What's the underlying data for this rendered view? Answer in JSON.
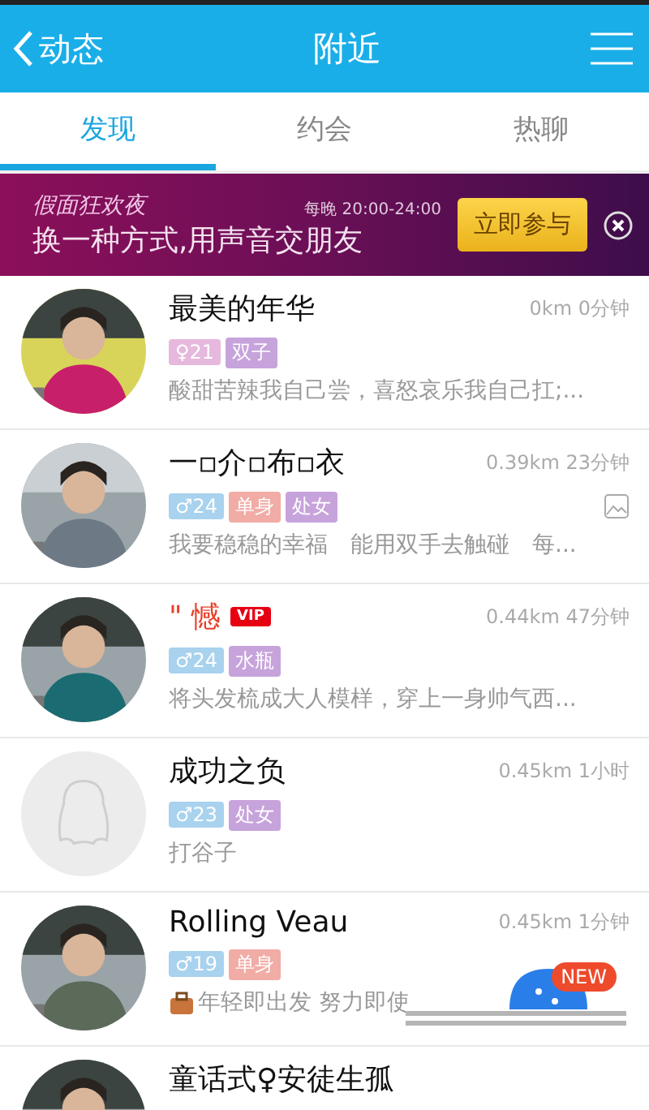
{
  "header": {
    "back_label": "动态",
    "title": "附近"
  },
  "tabs": [
    {
      "label": "发现",
      "selected": true
    },
    {
      "label": "约会",
      "selected": false
    },
    {
      "label": "热聊",
      "selected": false
    }
  ],
  "banner": {
    "event_title": "假面狂欢夜",
    "schedule": "每晚 20:00-24:00",
    "slogan": "换一种方式,用声音交朋友",
    "button": "立即参与"
  },
  "people": [
    {
      "name": "最美的年华",
      "distance_time": "0km 0分钟",
      "default_avatar": false,
      "tags": [
        {
          "text": "♀21",
          "color": "#e6b8dd"
        },
        {
          "text": "双子",
          "color": "#c7a3dc"
        }
      ],
      "status": "酸甜苦辣我自己尝，喜怒哀乐我自己扛;...",
      "has_photos": false,
      "status_icon": false
    },
    {
      "name": "一▫介▫布▫衣",
      "distance_time": "0.39km 23分钟",
      "default_avatar": false,
      "tags": [
        {
          "text": "♂24",
          "color": "#a8d2ee"
        },
        {
          "text": "单身",
          "color": "#f1aca6"
        },
        {
          "text": "处女",
          "color": "#c7a3dc"
        }
      ],
      "status": "我要稳稳的幸福　能用双手去触碰　每...",
      "has_photos": true,
      "status_icon": false
    },
    {
      "name": "\" 憾",
      "badge": "VIP",
      "distance_time": "0.44km 47分钟",
      "default_avatar": false,
      "tags": [
        {
          "text": "♂24",
          "color": "#a8d2ee"
        },
        {
          "text": "水瓶",
          "color": "#c7a3dc"
        }
      ],
      "status": "将头发梳成大人模样，穿上一身帅气西...",
      "has_photos": false,
      "status_icon": false
    },
    {
      "name": "成功之负",
      "distance_time": "0.45km 1小时",
      "default_avatar": true,
      "tags": [
        {
          "text": "♂23",
          "color": "#a8d2ee"
        },
        {
          "text": "处女",
          "color": "#c7a3dc"
        }
      ],
      "status": "打谷子",
      "has_photos": false,
      "status_icon": false
    },
    {
      "name": "Rolling Veau",
      "distance_time": "0.45km 1分钟",
      "default_avatar": false,
      "tags": [
        {
          "text": "♂19",
          "color": "#a8d2ee"
        },
        {
          "text": "单身",
          "color": "#f1aca6"
        }
      ],
      "status": "年轻即出发 努力即使",
      "has_photos": false,
      "status_icon": true
    },
    {
      "name": "童话式♀安徒生孤",
      "default_avatar": false,
      "has_photos": false,
      "status_icon": false
    }
  ],
  "floating_badge": "NEW"
}
